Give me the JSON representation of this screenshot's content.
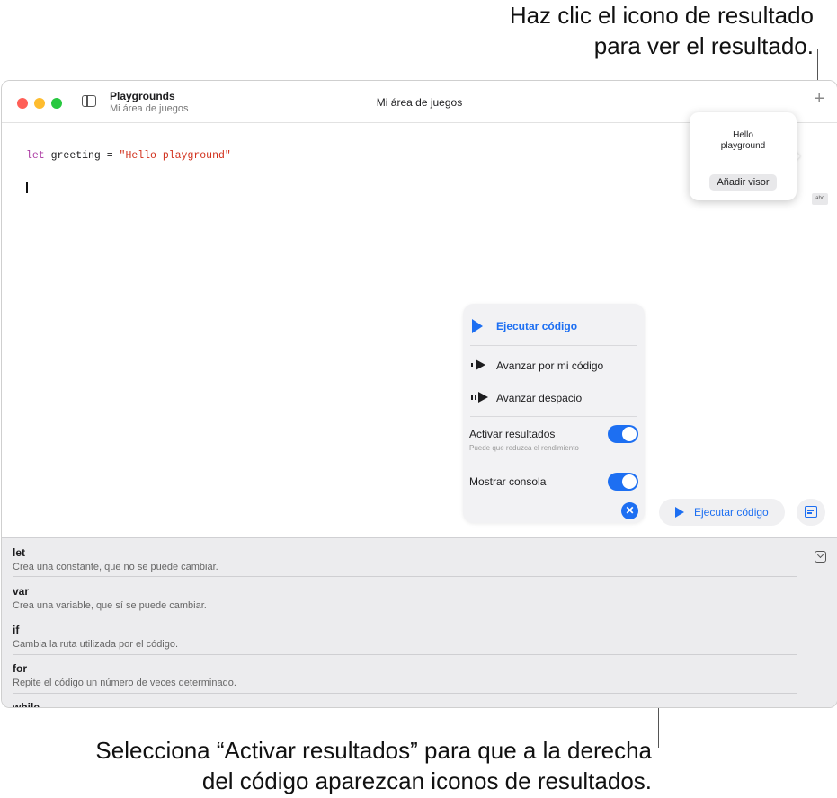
{
  "callouts": {
    "top_line1": "Haz clic el icono de resultado",
    "top_line2": "para ver el resultado.",
    "bottom_line1": "Selecciona “Activar resultados” para que a la derecha",
    "bottom_line2": "del código aparezcan iconos de resultados."
  },
  "titlebar": {
    "app_title": "Playgrounds",
    "app_subtitle": "Mi área de juegos",
    "document_title": "Mi área de juegos",
    "add_symbol": "+"
  },
  "editor": {
    "code_keyword": "let",
    "code_middle": " greeting = ",
    "code_string": "\"Hello playground\""
  },
  "result": {
    "icon_label": "abc",
    "popover_line1": "Hello",
    "popover_line2": "playground",
    "add_viewer_label": "Añadir visor"
  },
  "run_menu": {
    "run_code": "Ejecutar código",
    "step_through": "Avanzar por mi código",
    "step_slowly": "Avanzar despacio",
    "enable_results": "Activar resultados",
    "enable_results_hint": "Puede que reduzca el rendimiento",
    "show_console": "Mostrar consola",
    "close_symbol": "✕",
    "enable_results_on": true,
    "show_console_on": true
  },
  "toolbar": {
    "run_button_label": "Ejecutar código"
  },
  "shortcuts": [
    {
      "name": "let",
      "desc": "Crea una constante, que no se puede cambiar."
    },
    {
      "name": "var",
      "desc": "Crea una variable, que sí se puede cambiar."
    },
    {
      "name": "if",
      "desc": "Cambia la ruta utilizada por el código."
    },
    {
      "name": "for",
      "desc": "Repite el código un número de veces determinado."
    },
    {
      "name": "while",
      "desc": ""
    }
  ],
  "colors": {
    "accent": "#1d6ff2",
    "traffic_close": "#ff5f57",
    "traffic_min": "#febc2e",
    "traffic_max": "#28c840",
    "keyword": "#ad3da4",
    "string": "#d12f1b"
  }
}
